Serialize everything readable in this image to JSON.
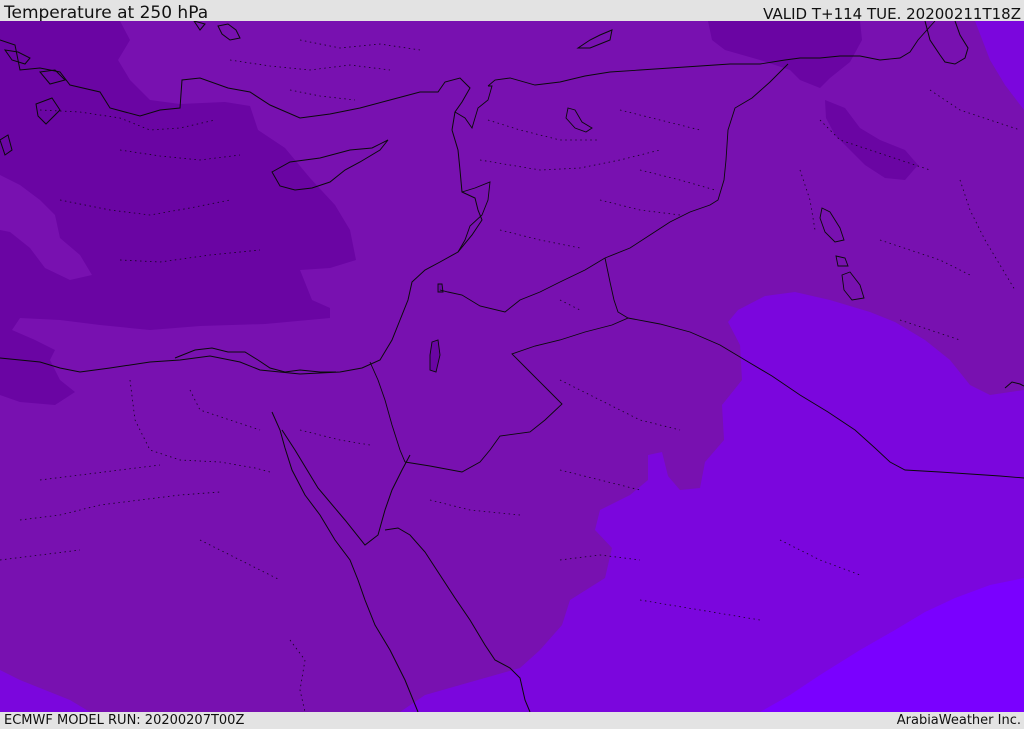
{
  "header": {
    "title": "Temperature at 250 hPa",
    "valid_time": "VALID T+114 TUE. 20200211T18Z"
  },
  "footer": {
    "model_run": "ECMWF MODEL RUN: 20200207T00Z",
    "credit": "ArabiaWeather Inc."
  },
  "colors": {
    "frame_background": "#e3e3e3",
    "band_mid": "#7811b0",
    "band_cold": "#6a05a3",
    "band_warm": "#7b06dd",
    "band_warmest": "#7a00ff",
    "coastline": "#0a0a0a"
  },
  "map": {
    "type": "filled temperature contour map",
    "features": [
      "coastline",
      "country-borders",
      "region-borders",
      "lakes"
    ]
  }
}
